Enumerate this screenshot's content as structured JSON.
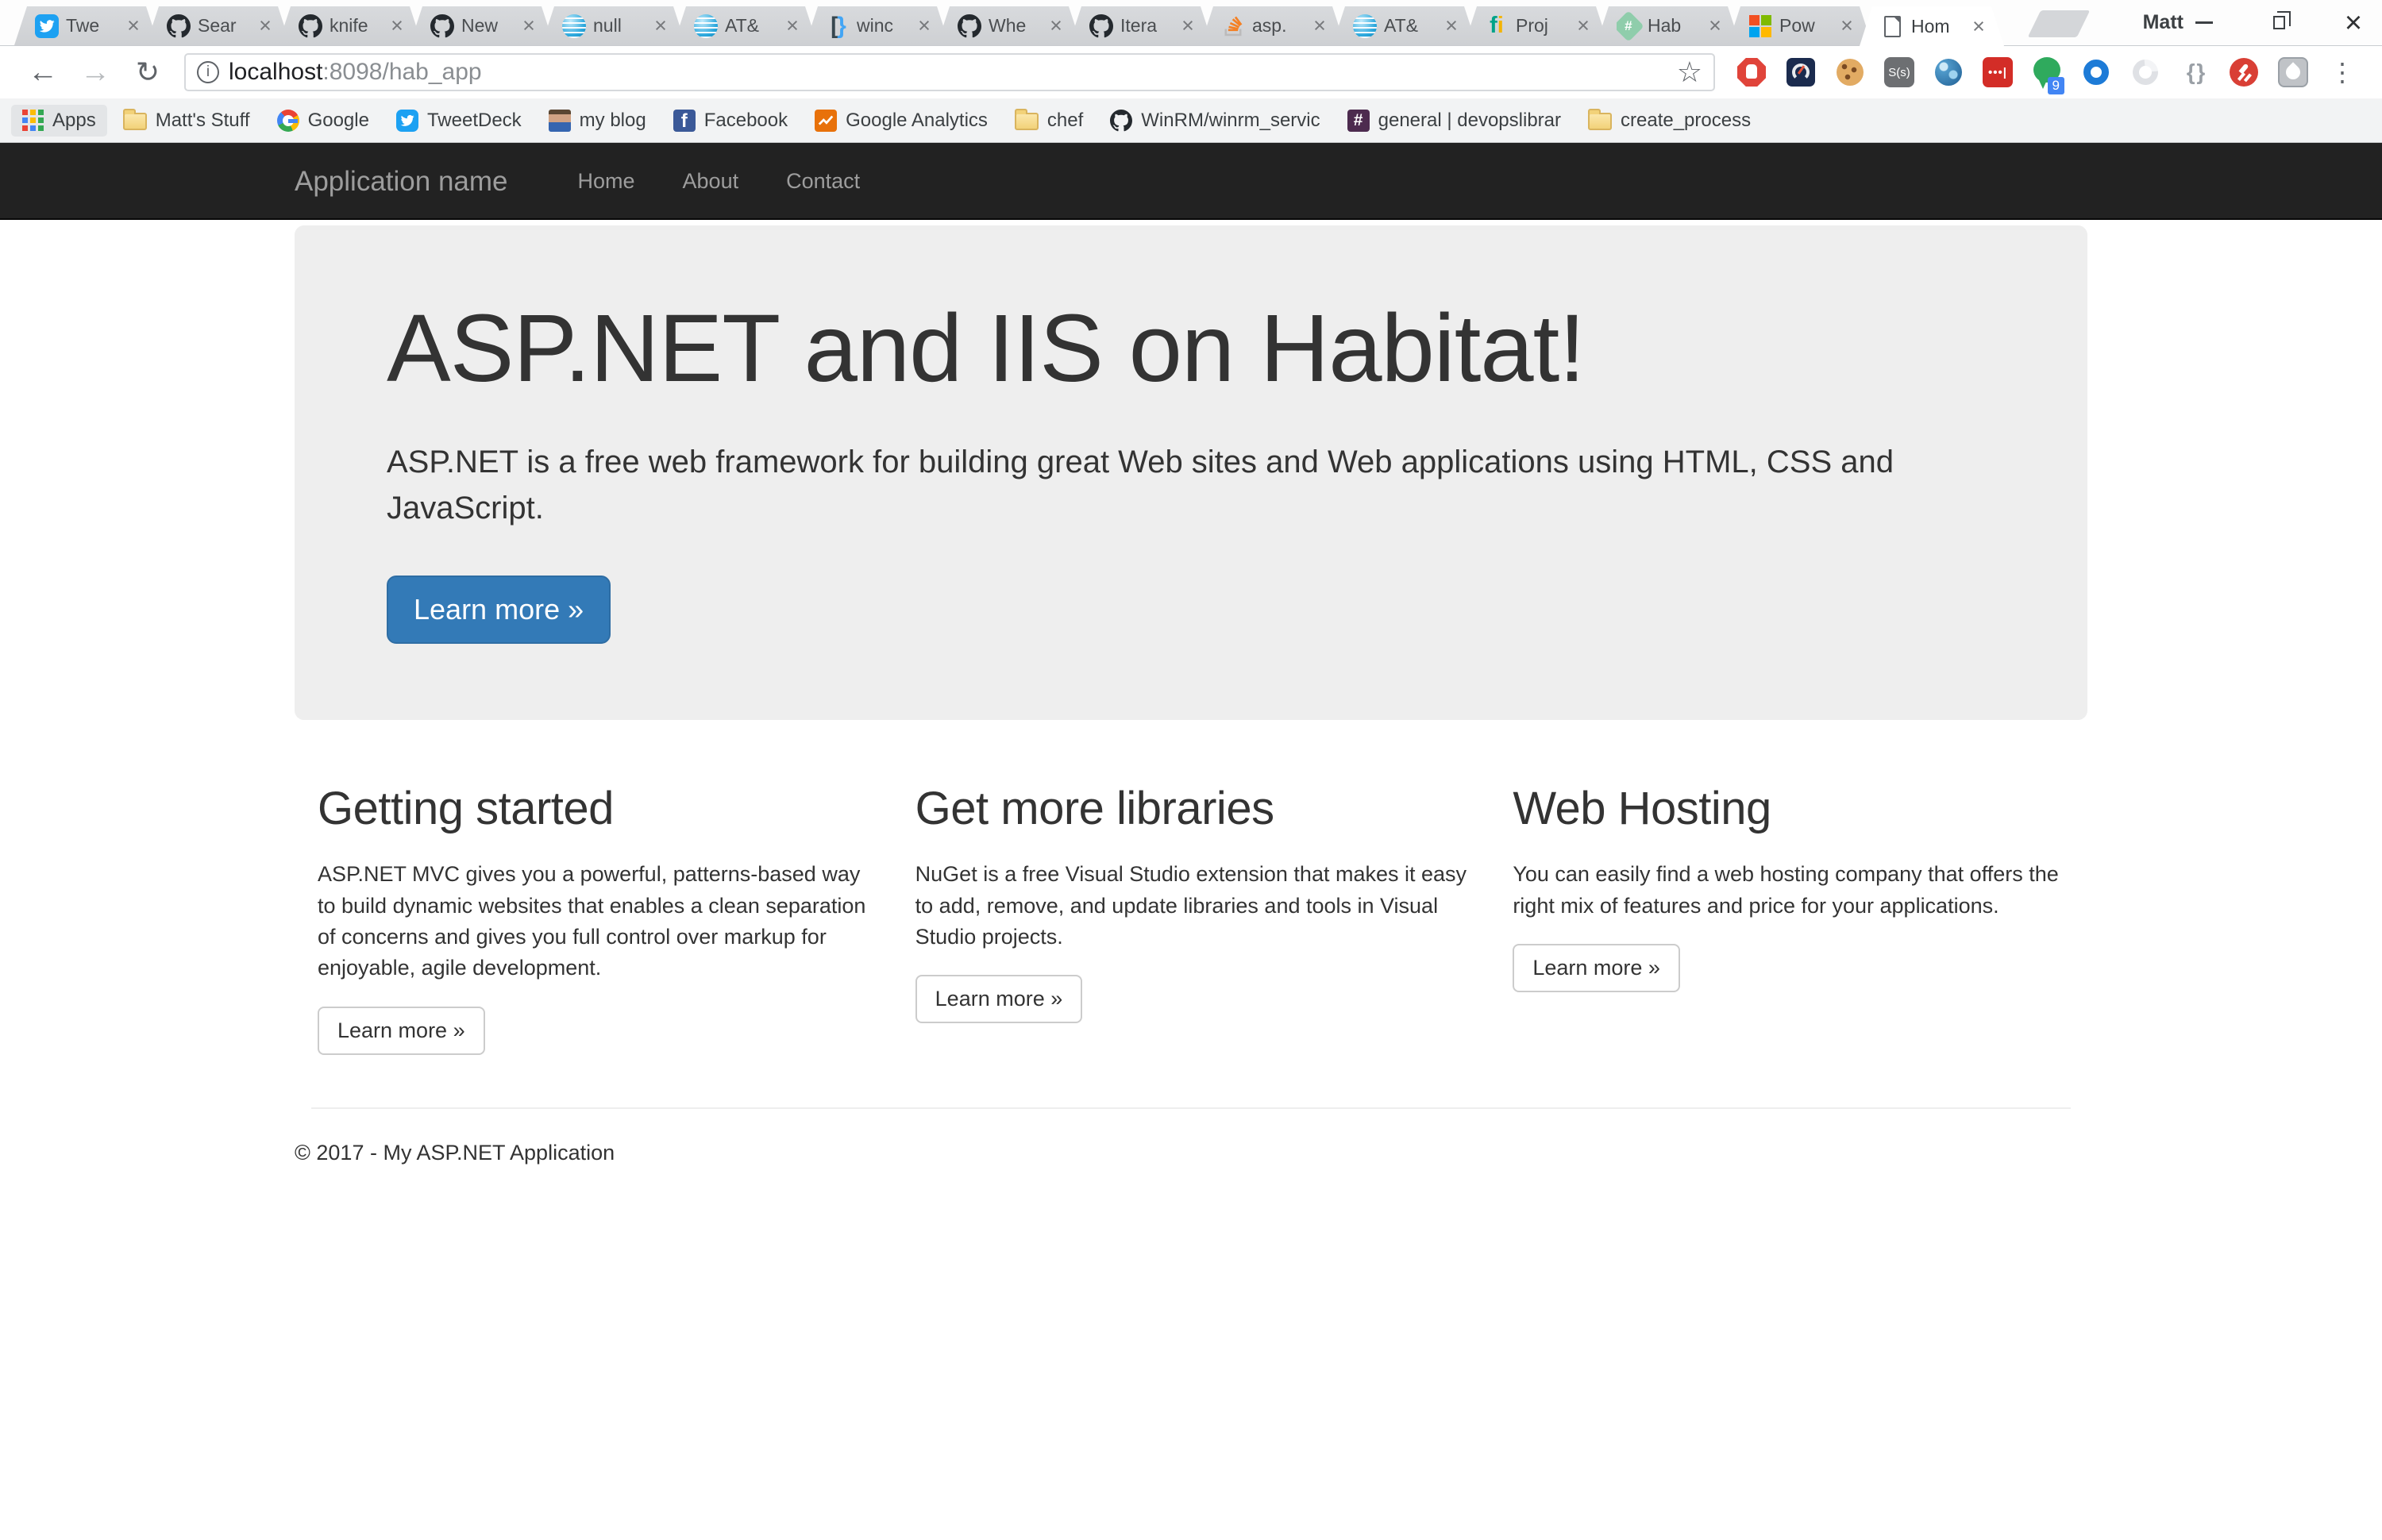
{
  "window": {
    "profile_name": "Matt",
    "controls": [
      "minimize-icon",
      "restore-icon",
      "close-icon"
    ]
  },
  "tabs": [
    {
      "title": "Twe",
      "icon": "twitter-icon"
    },
    {
      "title": "Sear",
      "icon": "github-icon"
    },
    {
      "title": "knife",
      "icon": "github-icon"
    },
    {
      "title": "New",
      "icon": "github-icon"
    },
    {
      "title": "null",
      "icon": "att-globe-icon"
    },
    {
      "title": "AT&",
      "icon": "att-globe-icon"
    },
    {
      "title": "winc",
      "icon": "code-brackets-icon"
    },
    {
      "title": "Whe",
      "icon": "github-icon"
    },
    {
      "title": "Itera",
      "icon": "github-icon"
    },
    {
      "title": "asp.",
      "icon": "stackoverflow-icon"
    },
    {
      "title": "AT&",
      "icon": "att-globe-icon"
    },
    {
      "title": "Proj",
      "icon": "project-fi-icon"
    },
    {
      "title": "Hab",
      "icon": "habitat-icon"
    },
    {
      "title": "Pow",
      "icon": "microsoft-icon"
    },
    {
      "title": "Hom",
      "icon": "page-icon",
      "active": true
    }
  ],
  "toolbar": {
    "url_host": "localhost",
    "url_path": ":8098/hab_app",
    "notifier_badge": "9",
    "extensions": [
      "bookmark-star-icon",
      "adblock-icon",
      "speedometer-icon",
      "cookie-icon",
      "styles-icon",
      "globe-icon",
      "lastpass-icon",
      "notifier-bubble-icon",
      "blue-ring-icon",
      "swirl-icon",
      "braces-icon",
      "disconnect-icon",
      "screenshot-icon",
      "browser-menu-icon"
    ]
  },
  "bookmarks": {
    "apps_label": "Apps",
    "items": [
      {
        "label": "Matt's Stuff",
        "icon": "folder-icon"
      },
      {
        "label": "Google",
        "icon": "google-icon"
      },
      {
        "label": "TweetDeck",
        "icon": "tweetdeck-icon"
      },
      {
        "label": "my blog",
        "icon": "avatar-icon"
      },
      {
        "label": "Facebook",
        "icon": "facebook-icon"
      },
      {
        "label": "Google Analytics",
        "icon": "analytics-icon"
      },
      {
        "label": "chef",
        "icon": "folder-icon"
      },
      {
        "label": "WinRM/winrm_servic",
        "icon": "github-icon"
      },
      {
        "label": "general | devopslibrar",
        "icon": "slack-icon"
      },
      {
        "label": "create_process",
        "icon": "folder-icon"
      }
    ]
  },
  "page": {
    "navbar": {
      "brand": "Application name",
      "links": [
        "Home",
        "About",
        "Contact"
      ]
    },
    "jumbotron": {
      "title": "ASP.NET and IIS on Habitat!",
      "text": "ASP.NET is a free web framework for building great Web sites and Web applications using HTML, CSS and JavaScript.",
      "cta": "Learn more »"
    },
    "columns": [
      {
        "heading": "Getting started",
        "text": "ASP.NET MVC gives you a powerful, patterns-based way to build dynamic websites that enables a clean separation of concerns and gives you full control over markup for enjoyable, agile development.",
        "cta": "Learn more »"
      },
      {
        "heading": "Get more libraries",
        "text": "NuGet is a free Visual Studio extension that makes it easy to add, remove, and update libraries and tools in Visual Studio projects.",
        "cta": "Learn more »"
      },
      {
        "heading": "Web Hosting",
        "text": "You can easily find a web hosting company that offers the right mix of features and price for your applications.",
        "cta": "Learn more »"
      }
    ],
    "footer": "© 2017 - My ASP.NET Application"
  },
  "colors": {
    "accent_primary": "#337ab7",
    "navbar_bg": "#222222",
    "jumbotron_bg": "#eeeeee",
    "tab_inactive": "#d2d4d7"
  }
}
